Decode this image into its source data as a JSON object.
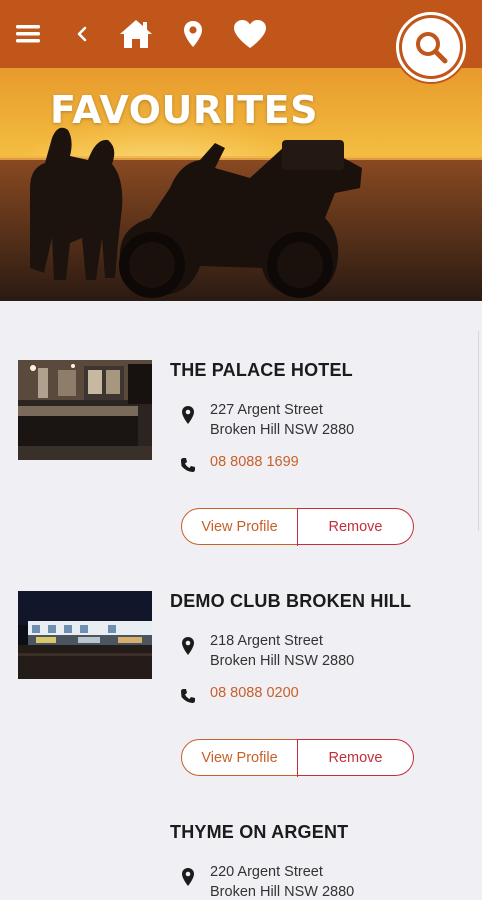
{
  "header": {
    "menu_icon": "hamburger-menu-icon",
    "back_icon": "chevron-left-icon",
    "home_icon": "home-icon",
    "location_icon": "map-pin-icon",
    "favourites_icon": "heart-icon",
    "search_icon": "search-icon",
    "bar_color": "#c0561a"
  },
  "hero": {
    "title": "FAVOURITES"
  },
  "favourites": [
    {
      "name": "THE PALACE HOTEL",
      "address_line1": "227 Argent Street",
      "address_line2": "Broken Hill NSW 2880",
      "phone": "08 8088 1699",
      "view_label": "View Profile",
      "remove_label": "Remove"
    },
    {
      "name": "DEMO CLUB BROKEN HILL",
      "address_line1": "218 Argent Street",
      "address_line2": "Broken Hill NSW 2880",
      "phone": "08 8088 0200",
      "view_label": "View Profile",
      "remove_label": "Remove"
    },
    {
      "name": "THYME ON ARGENT",
      "address_line1": "220 Argent Street",
      "address_line2": "Broken Hill NSW 2880"
    }
  ],
  "colors": {
    "accent": "#c8602a",
    "remove": "#c42e3a",
    "background": "#f0eff4"
  }
}
